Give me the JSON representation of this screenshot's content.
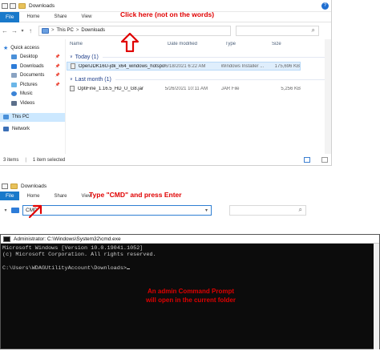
{
  "explorer": {
    "title": "Downloads",
    "help_glyph": "?",
    "ribbon": {
      "file": "File",
      "tabs": [
        "Home",
        "Share",
        "View"
      ]
    },
    "address": {
      "back": "←",
      "forward": "→",
      "dropdown": "▾",
      "up": "↑",
      "crumbs": [
        "This PC",
        "Downloads"
      ],
      "separator": ">",
      "search_glyph": "⌕"
    },
    "nav": {
      "quick_access": "Quick access",
      "items": [
        "Desktop",
        "Downloads",
        "Documents",
        "Pictures",
        "Music",
        "Videos"
      ],
      "this_pc": "This PC",
      "network": "Network"
    },
    "columns": [
      "Name",
      "Date modified",
      "Type",
      "Size"
    ],
    "groups": [
      {
        "label": "Today (1)",
        "files": [
          {
            "name": "OpenJDK16U-jdk_x64_windows_hotspot_...",
            "date": "6/18/2021 6:22 AM",
            "type": "Windows Installer ...",
            "size": "175,696 KB"
          }
        ]
      },
      {
        "label": "Last month (1)",
        "files": [
          {
            "name": "OptiFine_1.16.5_HD_U_G8.jar",
            "date": "5/26/2021 10:11 AM",
            "type": "JAR File",
            "size": "5,256 KB"
          }
        ]
      }
    ],
    "status": {
      "items": "3 items",
      "selected": "1 item selected"
    }
  },
  "callouts": {
    "click_here": "Click here (not on the words)",
    "type_cmd": "Type \"CMD\" and press Enter",
    "admin_prompt_line1": "An admin Command Prompt",
    "admin_prompt_line2": "will open in the current folder"
  },
  "explorer2": {
    "title": "Downloads",
    "ribbon": {
      "file": "File",
      "tabs": [
        "Home",
        "Share",
        "View"
      ]
    },
    "address_value": "CMD",
    "dropdown": "▾",
    "search_glyph": "⌕"
  },
  "cmd": {
    "title": "Administrator: C:\\Windows\\System32\\cmd.exe",
    "lines": [
      "Microsoft Windows [Version 10.0.19041.1052]",
      "(c) Microsoft Corporation. All rights reserved.",
      "",
      "C:\\Users\\WDAGUtilityAccount\\Downloads>"
    ]
  },
  "colors": {
    "accent": "#1979ca",
    "callout_red": "#e00000",
    "console_bg": "#0c0c0c"
  }
}
